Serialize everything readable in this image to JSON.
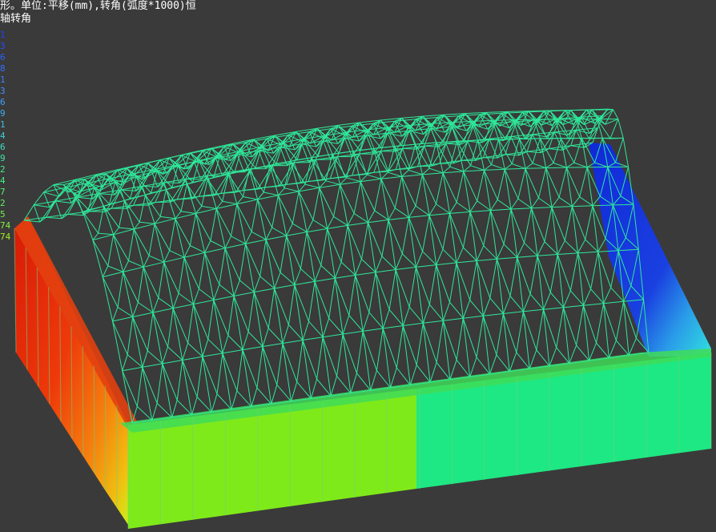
{
  "header": {
    "title_line1": "形。单位:平移(mm),转角(弧度*1000)恒",
    "title_line2": "轴转角"
  },
  "legend": {
    "labels": [
      {
        "text": "1",
        "color": "#2040ff"
      },
      {
        "text": "3",
        "color": "#2050ff"
      },
      {
        "text": "6",
        "color": "#2a60ff"
      },
      {
        "text": "8",
        "color": "#3070ff"
      },
      {
        "text": "1",
        "color": "#3a80ff"
      },
      {
        "text": "3",
        "color": "#4090ff"
      },
      {
        "text": "6",
        "color": "#40a0ff"
      },
      {
        "text": "9",
        "color": "#40b0f0"
      },
      {
        "text": "1",
        "color": "#40c0e0"
      },
      {
        "text": "4",
        "color": "#40d0d0"
      },
      {
        "text": "6",
        "color": "#40e0c0"
      },
      {
        "text": "9",
        "color": "#40e8a8"
      },
      {
        "text": "2",
        "color": "#40f090"
      },
      {
        "text": "4",
        "color": "#40f080"
      },
      {
        "text": "7",
        "color": "#50f070"
      },
      {
        "text": "2",
        "color": "#60f060"
      },
      {
        "text": "5",
        "color": "#70f050"
      },
      {
        "text": "74",
        "color": "#80f040"
      },
      {
        "text": "74",
        "color": "#a0f020"
      },
      {
        "text": "",
        "color": "#c0f000"
      },
      {
        "text": "",
        "color": "#e0e000"
      },
      {
        "text": "",
        "color": "#f0d000"
      },
      {
        "text": "",
        "color": "#f0c000"
      },
      {
        "text": "",
        "color": "#f0b000"
      },
      {
        "text": "",
        "color": "#f0a000"
      },
      {
        "text": "",
        "color": "#f09000"
      },
      {
        "text": "",
        "color": "#f08000"
      },
      {
        "text": "",
        "color": "#f07000"
      },
      {
        "text": "",
        "color": "#f06000"
      },
      {
        "text": "",
        "color": "#f05000"
      },
      {
        "text": "",
        "color": "#f04000"
      },
      {
        "text": "",
        "color": "#f03000"
      },
      {
        "text": "",
        "color": "#f02000"
      }
    ]
  },
  "colors": {
    "background": "#3a3a3a",
    "mesh": "#2ee89a",
    "wall_green": "#7fea1a",
    "wall_teal": "#1ee883",
    "wall_red": "#e52a0c",
    "wall_orange": "#f38a12",
    "wall_blue": "#1a3cdc",
    "wall_cyan": "#27d8e8"
  }
}
